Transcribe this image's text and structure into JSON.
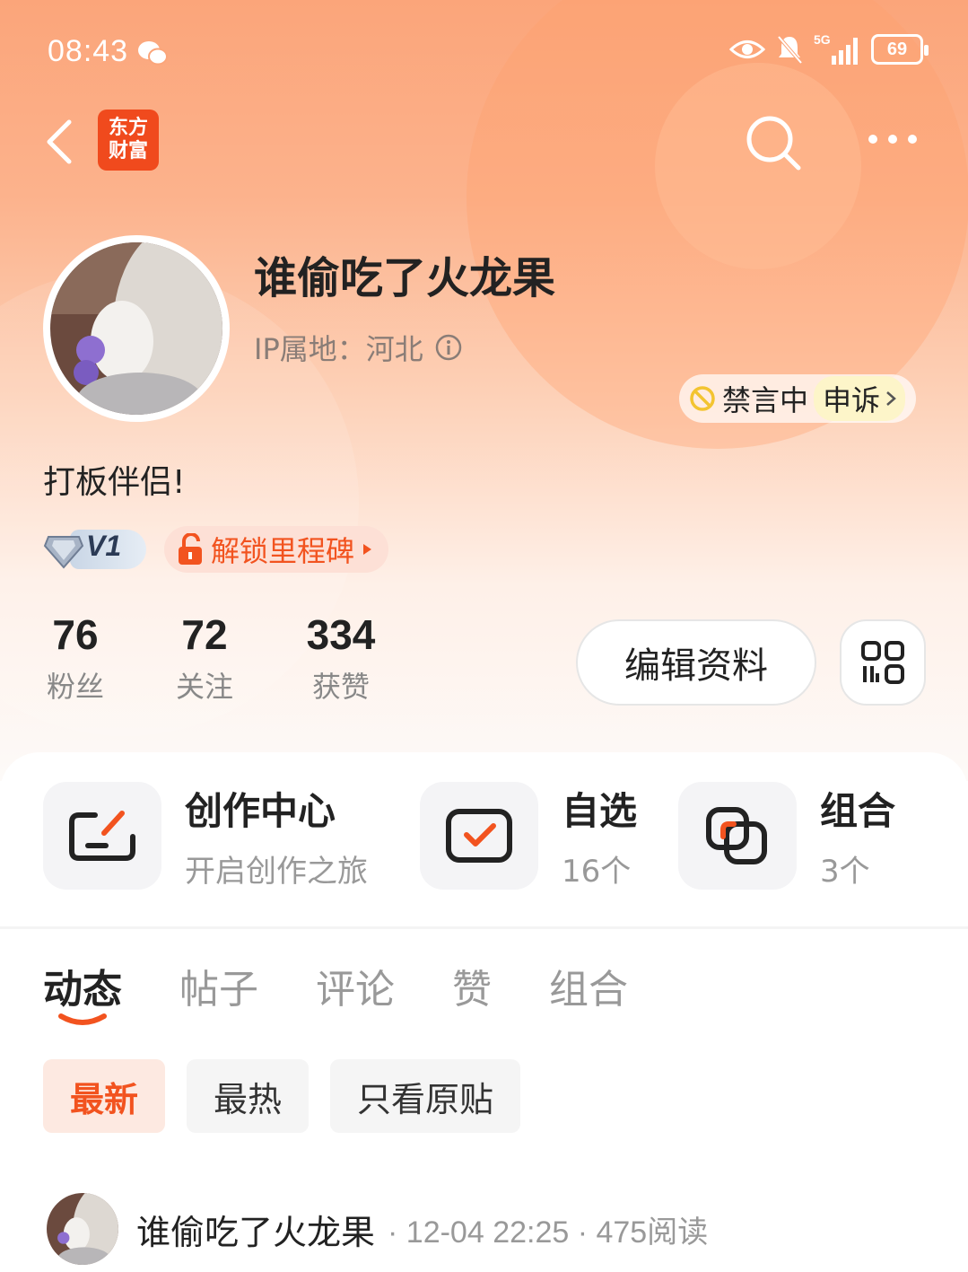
{
  "status_bar": {
    "time": "08:43",
    "network": "5G",
    "battery": "69"
  },
  "app": {
    "logo_line1": "东方",
    "logo_line2": "财富"
  },
  "profile": {
    "username": "谁偷吃了火龙果",
    "ip_location": "IP属地：河北",
    "mute_status": "禁言中",
    "appeal": "申诉",
    "bio": "打板伴侣!",
    "level": "V1",
    "milestone": "解锁里程碑"
  },
  "stats": [
    {
      "value": "76",
      "label": "粉丝"
    },
    {
      "value": "72",
      "label": "关注"
    },
    {
      "value": "334",
      "label": "获赞"
    }
  ],
  "actions": {
    "edit_profile": "编辑资料"
  },
  "entries": [
    {
      "title": "创作中心",
      "subtitle": "开启创作之旅",
      "icon": "pen-icon"
    },
    {
      "title": "自选",
      "subtitle": "16个",
      "icon": "checkbox-icon"
    },
    {
      "title": "组合",
      "subtitle": "3个",
      "icon": "portfolio-icon"
    }
  ],
  "tabs": [
    "动态",
    "帖子",
    "评论",
    "赞",
    "组合"
  ],
  "active_tab": "动态",
  "filters": [
    "最新",
    "最热",
    "只看原贴"
  ],
  "post": {
    "author": "谁偷吃了火龙果",
    "meta": "· 12-04 22:25 · 475阅读"
  },
  "colors": {
    "accent": "#f2531f",
    "hero_top": "#fba57a",
    "logo_red": "#f04a1d"
  }
}
